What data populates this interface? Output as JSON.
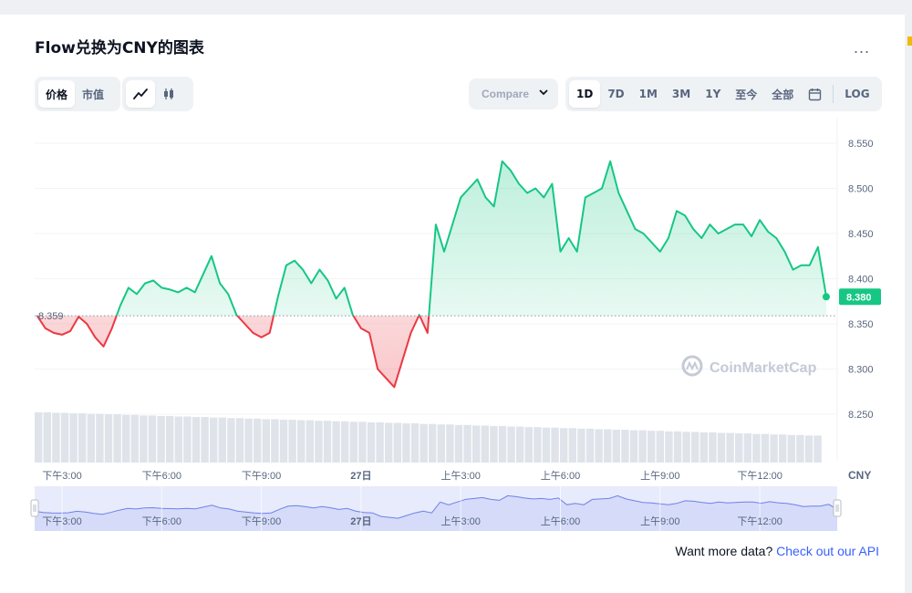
{
  "header": {
    "title": "Flow兑换为CNY的图表",
    "more_label": "..."
  },
  "toolbar": {
    "metric_tabs": [
      {
        "label": "价格",
        "active": true
      },
      {
        "label": "市值",
        "active": false
      }
    ],
    "chart_type_icons": [
      {
        "name": "line-chart-icon",
        "active": true
      },
      {
        "name": "candlestick-icon",
        "active": false
      }
    ],
    "compare_label": "Compare",
    "ranges": [
      {
        "label": "1D",
        "active": true
      },
      {
        "label": "7D",
        "active": false
      },
      {
        "label": "1M",
        "active": false
      },
      {
        "label": "3M",
        "active": false
      },
      {
        "label": "1Y",
        "active": false
      },
      {
        "label": "至今",
        "active": false
      },
      {
        "label": "全部",
        "active": false
      }
    ],
    "log_label": "LOG"
  },
  "footer": {
    "prefix": "Want more data?",
    "link": "Check out our API"
  },
  "colors": {
    "up": "#16c784",
    "down": "#ea3943",
    "accent": "#3861fb"
  },
  "chart_data": {
    "type": "line",
    "currency": "CNY",
    "ylim": [
      8.2,
      8.575
    ],
    "y_ticks": [
      "8.550",
      "8.500",
      "8.450",
      "8.400",
      "8.350",
      "8.300",
      "8.250"
    ],
    "x_ticks": [
      "下午3:00",
      "下午6:00",
      "下午9:00",
      "27日",
      "上午3:00",
      "上午6:00",
      "上午9:00",
      "下午12:00"
    ],
    "x_tick_positions": [
      0.0,
      3.0,
      6.0,
      9.0,
      12.0,
      15.0,
      18.0,
      21.0
    ],
    "reference": {
      "value": 8.359,
      "label": "8.359"
    },
    "current": {
      "value": 8.38,
      "label": "8.380"
    },
    "watermark": "CoinMarketCap",
    "series": [
      {
        "x": [
          -0.75,
          -0.5,
          -0.25,
          0.0,
          0.25,
          0.5,
          0.75,
          1.0,
          1.25,
          1.5,
          1.75,
          2.0,
          2.25,
          2.5,
          2.75,
          3.0,
          3.25,
          3.5,
          3.75,
          4.0,
          4.25,
          4.5,
          4.75,
          5.0,
          5.25,
          5.5,
          5.75,
          6.0,
          6.25,
          6.5,
          6.75,
          7.0,
          7.25,
          7.5,
          7.75,
          8.0,
          8.25,
          8.5,
          8.75,
          9.0,
          9.25,
          9.5,
          9.75,
          10.0,
          10.25,
          10.5,
          10.75,
          11.0,
          11.25,
          11.5,
          11.75,
          12.0,
          12.25,
          12.5,
          12.75,
          13.0,
          13.25,
          13.5,
          13.75,
          14.0,
          14.25,
          14.5,
          14.75,
          15.0,
          15.25,
          15.5,
          15.75,
          16.0,
          16.25,
          16.5,
          16.75,
          17.0,
          17.25,
          17.5,
          17.75,
          18.0,
          18.25,
          18.5,
          18.75,
          19.0,
          19.25,
          19.5,
          19.75,
          20.0,
          20.25,
          20.5,
          20.75,
          21.0,
          21.25,
          21.5,
          21.75,
          22.0,
          22.25,
          22.5,
          22.75,
          23.0
        ],
        "values": [
          8.359,
          8.345,
          8.34,
          8.338,
          8.342,
          8.358,
          8.35,
          8.335,
          8.325,
          8.345,
          8.37,
          8.39,
          8.383,
          8.395,
          8.398,
          8.39,
          8.388,
          8.385,
          8.39,
          8.385,
          8.405,
          8.425,
          8.395,
          8.383,
          8.36,
          8.35,
          8.34,
          8.335,
          8.34,
          8.38,
          8.415,
          8.42,
          8.41,
          8.395,
          8.41,
          8.398,
          8.378,
          8.39,
          8.36,
          8.345,
          8.34,
          8.3,
          8.29,
          8.28,
          8.31,
          8.34,
          8.36,
          8.34,
          8.46,
          8.43,
          8.46,
          8.49,
          8.5,
          8.51,
          8.49,
          8.48,
          8.53,
          8.52,
          8.505,
          8.495,
          8.5,
          8.49,
          8.505,
          8.43,
          8.445,
          8.43,
          8.49,
          8.495,
          8.5,
          8.53,
          8.495,
          8.475,
          8.455,
          8.45,
          8.44,
          8.43,
          8.445,
          8.475,
          8.47,
          8.455,
          8.445,
          8.46,
          8.45,
          8.455,
          8.46,
          8.46,
          8.447,
          8.465,
          8.452,
          8.445,
          8.43,
          8.41,
          8.415,
          8.415,
          8.435,
          8.38
        ],
        "name": ""
      }
    ],
    "volume": [
      0.95,
      0.95,
      0.94,
      0.94,
      0.93,
      0.93,
      0.92,
      0.92,
      0.91,
      0.91,
      0.9,
      0.9,
      0.89,
      0.89,
      0.88,
      0.88,
      0.87,
      0.87,
      0.86,
      0.86,
      0.85,
      0.85,
      0.84,
      0.84,
      0.83,
      0.83,
      0.82,
      0.82,
      0.81,
      0.81,
      0.8,
      0.8,
      0.79,
      0.79,
      0.78,
      0.78,
      0.77,
      0.77,
      0.76,
      0.76,
      0.75,
      0.75,
      0.74,
      0.74,
      0.73,
      0.73,
      0.72,
      0.72,
      0.71,
      0.71,
      0.7,
      0.7,
      0.69,
      0.69,
      0.68,
      0.68,
      0.67,
      0.67,
      0.66,
      0.66,
      0.65,
      0.65,
      0.64,
      0.64,
      0.63,
      0.63,
      0.62,
      0.62,
      0.61,
      0.61,
      0.6,
      0.6,
      0.59,
      0.59,
      0.58,
      0.58,
      0.57,
      0.57,
      0.56,
      0.56,
      0.55,
      0.55,
      0.54,
      0.54,
      0.53,
      0.53,
      0.52,
      0.52,
      0.51,
      0.51
    ],
    "navigator_ticks": [
      "下午3:00",
      "下午6:00",
      "下午9:00",
      "27日",
      "上午3:00",
      "上午6:00",
      "上午9:00",
      "下午12:00"
    ]
  }
}
